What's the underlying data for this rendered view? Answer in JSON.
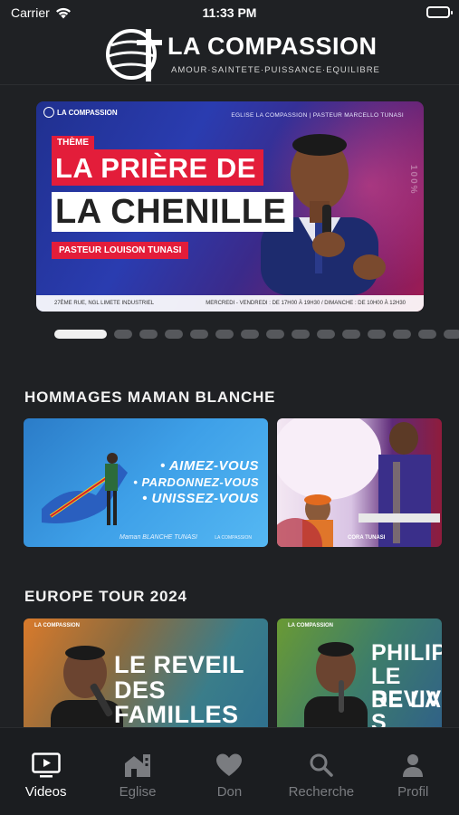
{
  "status_bar": {
    "carrier": "Carrier",
    "time": "11:33 PM"
  },
  "header": {
    "brand": "LA COMPASSION",
    "tagline": "AMOUR·SAINTETE·PUISSANCE·EQUILIBRE"
  },
  "hero": {
    "mini_logo": "LA COMPASSION",
    "topline": "EGLISE LA COMPASSION  |  PASTEUR MARCELLO TUNASI",
    "theme_label": "THÈME",
    "title_line1": "LA PRIÈRE DE",
    "title_line2": "LA CHENILLE",
    "pastor": "PASTEUR LOUISON TUNASI",
    "footer_left": "27ÈME RUE, NGL LIMETE INDUSTRIEL",
    "footer_right": "MERCREDI - VENDREDI : DE 17H00 À 19H30  /  DIMANCHE : DE 10H00 À 12H30",
    "side_text": "100%"
  },
  "pager": {
    "count": 15,
    "active_index": 0
  },
  "sections": {
    "hommages": {
      "title": "HOMMAGES MAMAN BLANCHE",
      "card1": {
        "line1": "• AIMEZ-VOUS",
        "line2": "• PARDONNEZ-VOUS",
        "line3": "• UNISSEZ-VOUS",
        "signature": "Maman BLANCHE TUNASI",
        "logo": "LA COMPASSION"
      },
      "card2": {
        "name": "CORA TUNASI"
      }
    },
    "europe": {
      "title": "EUROPE TOUR 2024",
      "card1": {
        "header": "LA COMPASSION",
        "line1": "LE REVEIL",
        "line2": "DES FAMILLES"
      },
      "card2": {
        "header": "LA COMPASSION",
        "line1": "PHILIPP",
        "line2": "LE REVIV",
        "line3": "DE LA S"
      }
    }
  },
  "tabs": [
    {
      "label": "Videos",
      "icon": "play-video-icon",
      "active": true
    },
    {
      "label": "Eglise",
      "icon": "church-icon",
      "active": false
    },
    {
      "label": "Don",
      "icon": "heart-icon",
      "active": false
    },
    {
      "label": "Recherche",
      "icon": "search-icon",
      "active": false
    },
    {
      "label": "Profil",
      "icon": "person-icon",
      "active": false
    }
  ],
  "colors": {
    "background": "#1f2124",
    "accent_red": "#e31d3a",
    "tab_active": "#ffffff",
    "tab_inactive": "#7a7c80"
  }
}
